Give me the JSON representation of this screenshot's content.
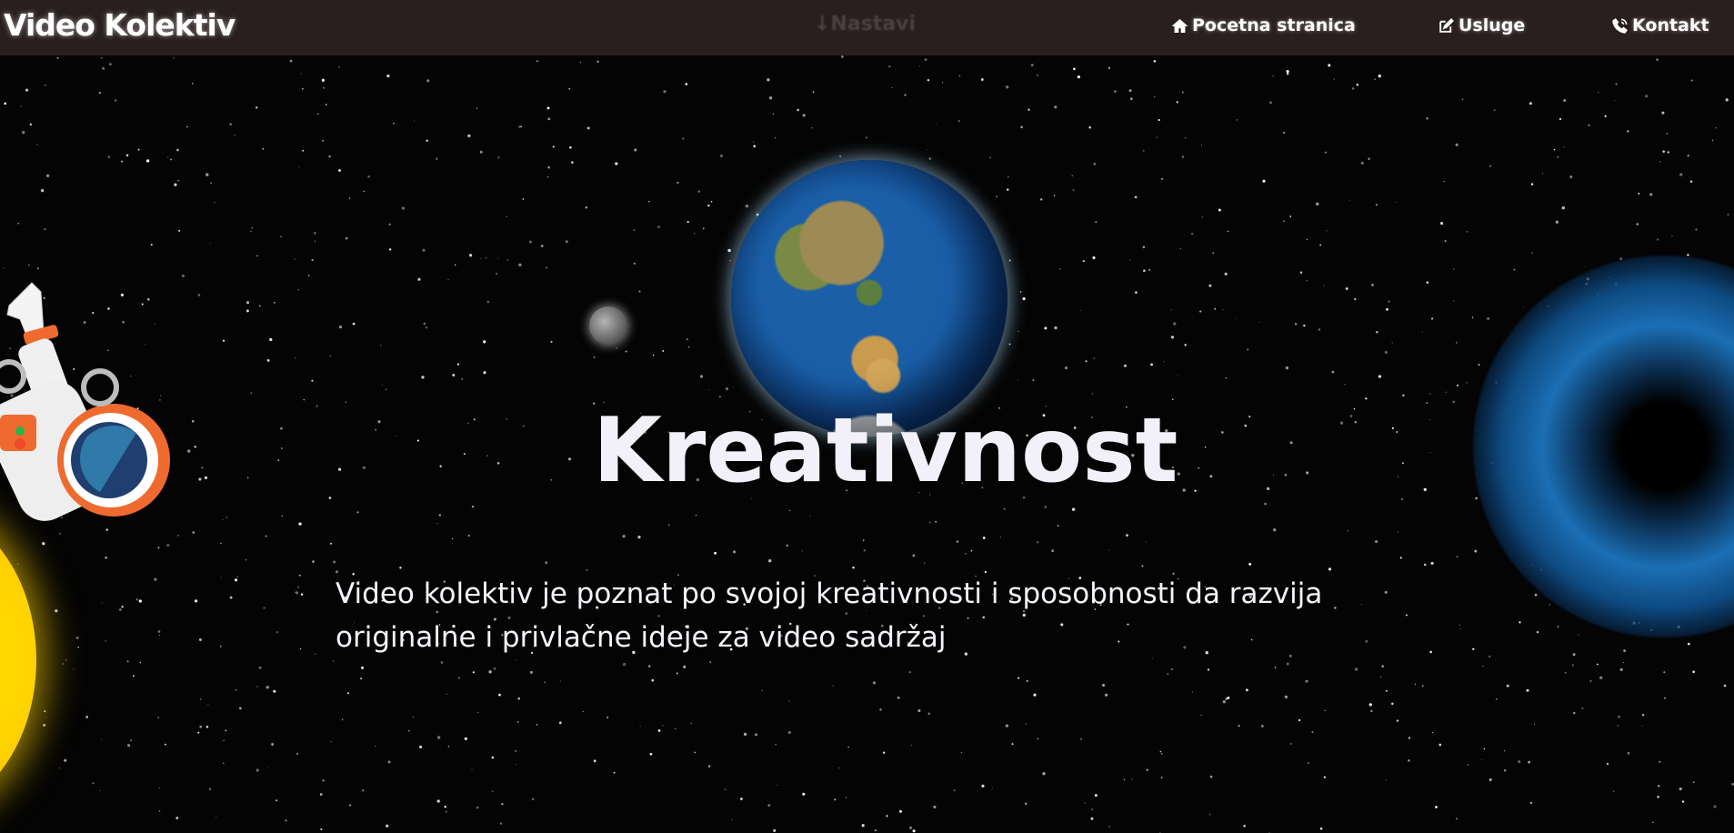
{
  "nav": {
    "brand": "Video Kolektiv",
    "center_label": "↓Nastavi",
    "links": [
      {
        "label": "Pocetna stranica",
        "icon": "home-icon"
      },
      {
        "label": "Usluge",
        "icon": "edit-icon"
      },
      {
        "label": "Kontakt",
        "icon": "phone-icon"
      }
    ]
  },
  "hero": {
    "title": "Kreativnost",
    "description": "Video kolektiv je poznat po svojoj kreativnosti i sposobnosti da razvija originalne i privlačne ideje za video sadržaj"
  },
  "colors": {
    "navbar": "#2a1f1f",
    "background": "#040404",
    "text": "#ffffff"
  }
}
